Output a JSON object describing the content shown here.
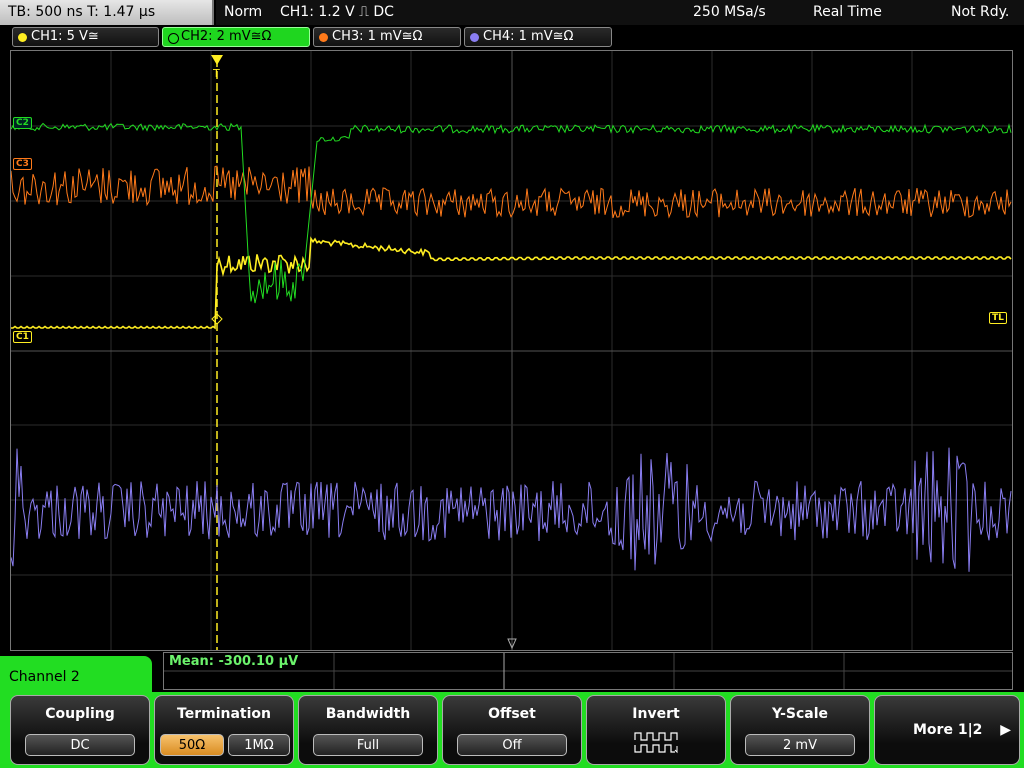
{
  "top_bar": {
    "timebase": "TB: 500 ns   T: 1.47 µs",
    "mode": "Norm",
    "trigger": "CH1: 1.2 V ⎍ DC",
    "sample_rate": "250 MSa/s",
    "acq_mode": "Real Time",
    "status": "Not Rdy."
  },
  "channels": [
    {
      "label": "CH1: 5 V≅",
      "color": "#ffee22",
      "active": false
    },
    {
      "label": "CH2: 2 mV≅Ω",
      "color": "#22dd22",
      "active": true
    },
    {
      "label": "CH3: 1 mV≅Ω",
      "color": "#ff7a1a",
      "active": false
    },
    {
      "label": "CH4: 1 mV≅Ω",
      "color": "#8a7ef2",
      "active": false
    }
  ],
  "markers": {
    "ch2": "C2",
    "ch3": "C3",
    "ch1": "C1",
    "trigger_level": "TL",
    "trigger_pos": "T"
  },
  "measurement": {
    "text": "Mean: -300.10 µV"
  },
  "channel_tab": "Channel 2",
  "softkeys": {
    "coupling": {
      "label": "Coupling",
      "value": "DC"
    },
    "termination": {
      "label": "Termination",
      "value_a": "50Ω",
      "value_b": "1MΩ"
    },
    "bandwidth": {
      "label": "Bandwidth",
      "value": "Full"
    },
    "offset": {
      "label": "Offset",
      "value": "Off"
    },
    "invert": {
      "label": "Invert"
    },
    "yscale": {
      "label": "Y-Scale",
      "value": "2 mV"
    },
    "more": {
      "label": "More 1|2",
      "arrow": "▶"
    }
  }
}
